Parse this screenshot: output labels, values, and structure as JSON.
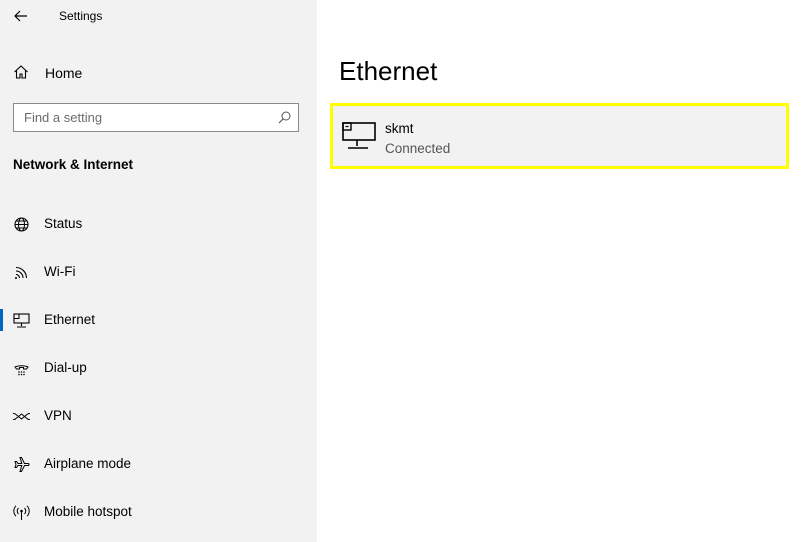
{
  "window": {
    "title": "Settings"
  },
  "sidebar": {
    "home_label": "Home",
    "search_placeholder": "Find a setting",
    "section_title": "Network & Internet",
    "items": [
      {
        "label": "Status",
        "icon": "globe-icon"
      },
      {
        "label": "Wi-Fi",
        "icon": "wifi-icon"
      },
      {
        "label": "Ethernet",
        "icon": "ethernet-icon",
        "selected": true
      },
      {
        "label": "Dial-up",
        "icon": "dialup-icon"
      },
      {
        "label": "VPN",
        "icon": "vpn-icon"
      },
      {
        "label": "Airplane mode",
        "icon": "airplane-icon"
      },
      {
        "label": "Mobile hotspot",
        "icon": "hotspot-icon"
      }
    ]
  },
  "main": {
    "title": "Ethernet",
    "adapter": {
      "name": "skmt",
      "status": "Connected",
      "icon": "network-computer-icon"
    }
  },
  "colors": {
    "accent": "#0067c0",
    "highlight_border": "#ffff00",
    "sidebar_bg": "#f2f2f2"
  }
}
